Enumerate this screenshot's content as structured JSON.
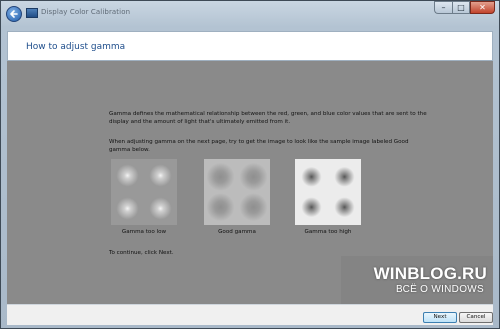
{
  "window": {
    "title": "Display Color Calibration",
    "controls": {
      "minimize": "–",
      "maximize": "□",
      "close": "✕"
    }
  },
  "header": {
    "title": "How to adjust gamma"
  },
  "content": {
    "para1": "Gamma defines the mathematical relationship between the red, green, and blue color values that are sent to the display and the amount of light that's ultimately emitted from it.",
    "para2": "When adjusting gamma on the next page, try to get the image to look like the sample image labeled Good gamma below.",
    "samples": [
      {
        "label": "Gamma too low"
      },
      {
        "label": "Good gamma"
      },
      {
        "label": "Gamma too high"
      }
    ],
    "para3": "To continue, click Next."
  },
  "watermark": {
    "line1": "WINBLOG.RU",
    "line2": "ВСЁ О WINDOWS"
  },
  "footer": {
    "next_label": "Next",
    "cancel_label": "Cancel"
  },
  "icons": {
    "back": "back-arrow-icon",
    "app": "display-calibration-icon"
  }
}
